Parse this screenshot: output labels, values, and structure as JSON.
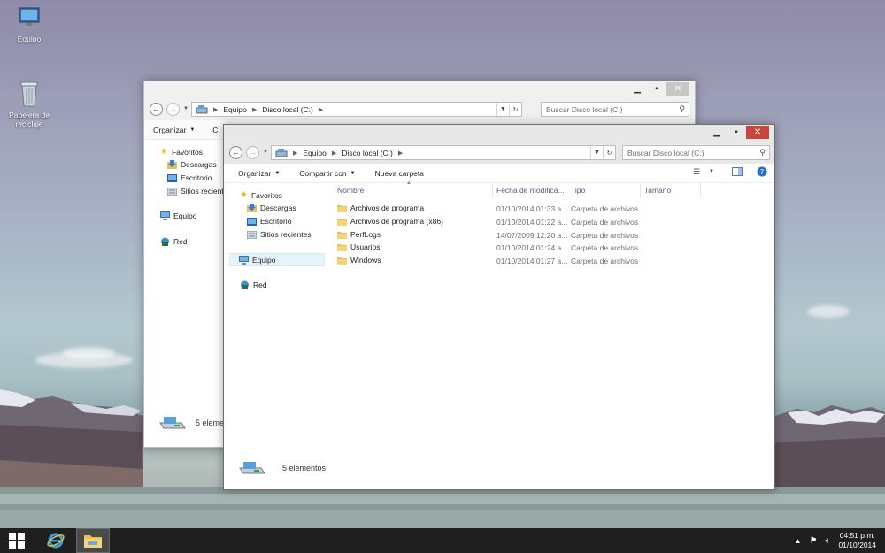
{
  "desktop": {
    "icons": [
      {
        "label": "Equipo"
      },
      {
        "label": "Papelera de reciclaje"
      }
    ]
  },
  "back_window": {
    "address": {
      "crumbs": [
        "Equipo",
        "Disco local (C:)"
      ]
    },
    "search_placeholder": "Buscar Disco local (C:)",
    "toolbar": {
      "organize": "Organizar"
    },
    "nav": {
      "favorites": "Favoritos",
      "downloads": "Descargas",
      "desktop": "Escritorio",
      "recent": "Sitios recientes",
      "computer": "Equipo",
      "network": "Red"
    },
    "status": "5 eleme"
  },
  "front_window": {
    "address": {
      "crumbs": [
        "Equipo",
        "Disco local (C:)"
      ]
    },
    "search_placeholder": "Buscar Disco local (C:)",
    "toolbar": {
      "organize": "Organizar",
      "share": "Compartir con",
      "new_folder": "Nueva carpeta"
    },
    "nav": {
      "favorites": "Favoritos",
      "downloads": "Descargas",
      "desktop": "Escritorio",
      "recent": "Sitios recientes",
      "computer": "Equipo",
      "network": "Red"
    },
    "columns": {
      "name": "Nombre",
      "date": "Fecha de modifica...",
      "type": "Tipo",
      "size": "Tamaño"
    },
    "rows": [
      {
        "name": "Archivos de programa",
        "date": "01/10/2014 01:33 a...",
        "type": "Carpeta de archivos"
      },
      {
        "name": "Archivos de programa (x86)",
        "date": "01/10/2014 01:22 a...",
        "type": "Carpeta de archivos"
      },
      {
        "name": "PerfLogs",
        "date": "14/07/2009 12:20 a...",
        "type": "Carpeta de archivos"
      },
      {
        "name": "Usuarios",
        "date": "01/10/2014 01:24 a...",
        "type": "Carpeta de archivos"
      },
      {
        "name": "Windows",
        "date": "01/10/2014 01:27 a...",
        "type": "Carpeta de archivos"
      }
    ],
    "status": "5 elementos"
  },
  "taskbar": {
    "time": "04:51 p.m.",
    "date": "01/10/2014"
  },
  "colors": {
    "taskbar": "#1f1f1f",
    "close_active": "#c8463c",
    "folder": "#e8c15a",
    "column_header": "#4c607a"
  }
}
